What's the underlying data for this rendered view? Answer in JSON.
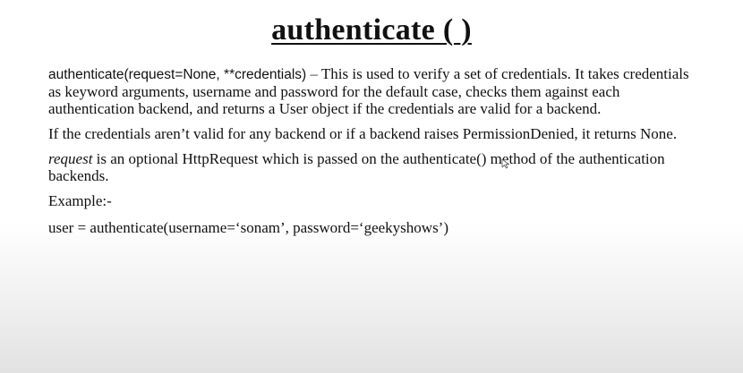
{
  "title": "authenticate ( )",
  "paragraph1": {
    "signature": "authenticate(request=None, **credentials)",
    "separator": "–",
    "text": "This is used to verify a set of credentials. It takes credentials as keyword arguments, username and password for the default case, checks them against each authentication backend, and returns a User object if the credentials are valid for a backend."
  },
  "paragraph2": "If the credentials aren’t valid for any backend or if a backend raises PermissionDenied, it returns None.",
  "paragraph3": {
    "emphasis": "request",
    "text": "is an optional HttpRequest which is passed on the authenticate() method of the authentication backends."
  },
  "example_label": "Example:-",
  "example_code": "user = authenticate(username=‘sonam’, password=‘geekyshows’)",
  "cursor_icon": "mouse-pointer-icon"
}
